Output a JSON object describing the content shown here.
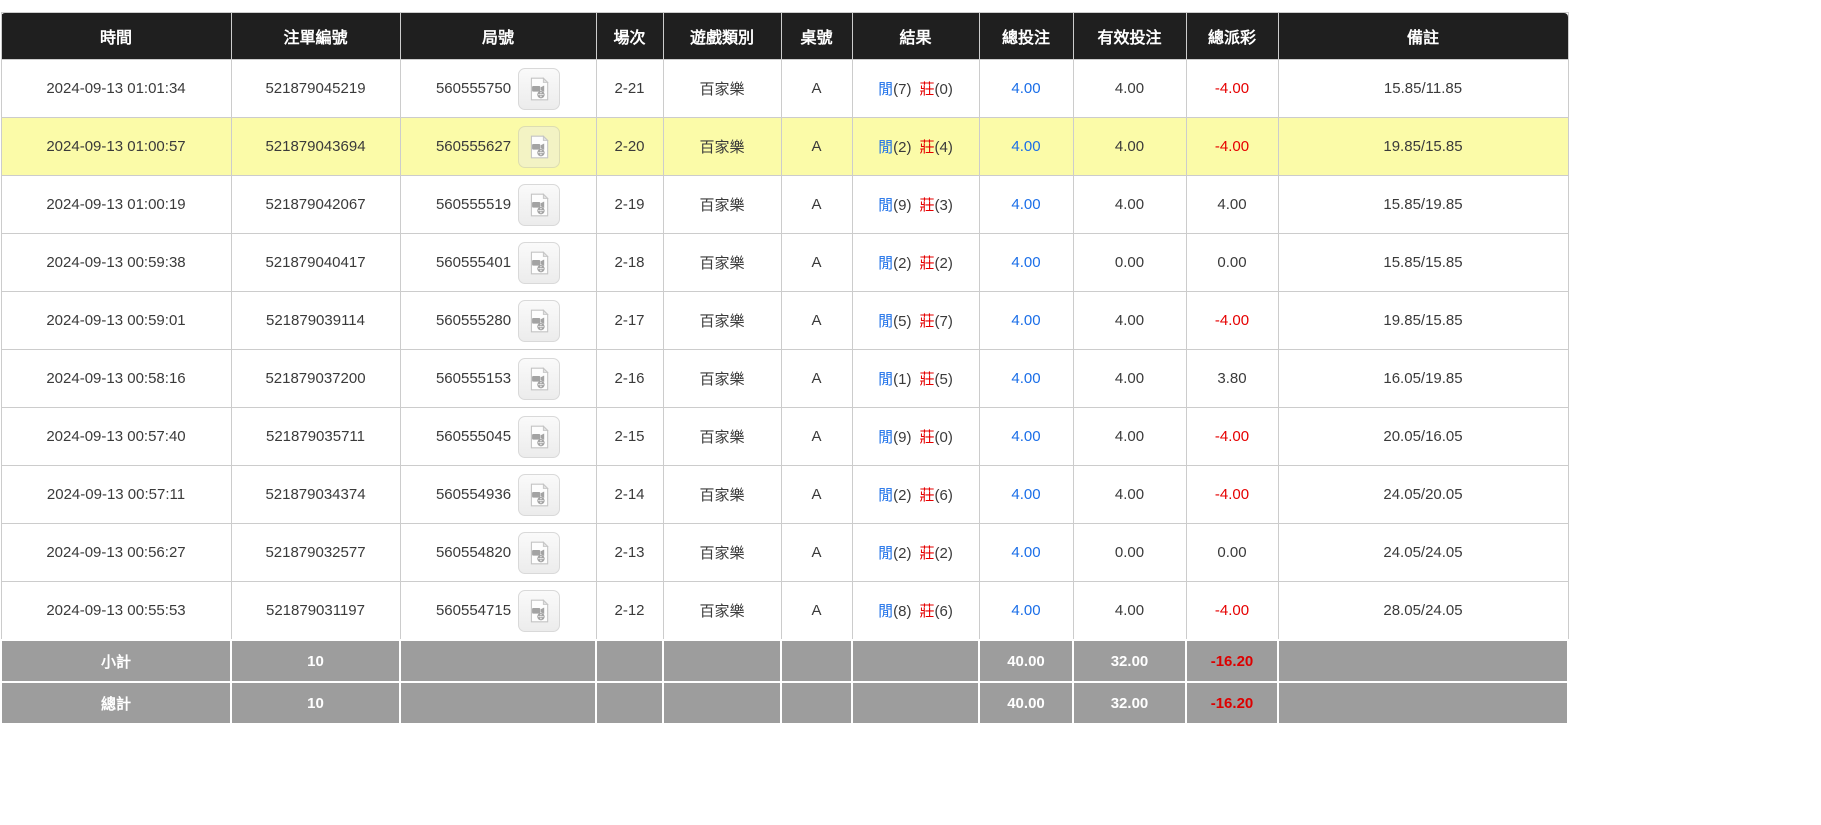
{
  "colors": {
    "accent_blue": "#1a6ee8",
    "negative_red": "#e60000",
    "footer_negative_red": "#dd0000",
    "highlight_yellow": "#fbfba8",
    "header_bg": "#1f1f1f",
    "footer_bg": "#9d9d9d"
  },
  "table": {
    "columns": [
      {
        "key": "time",
        "label": "時間"
      },
      {
        "key": "bet_id",
        "label": "注單編號"
      },
      {
        "key": "round_id",
        "label": "局號"
      },
      {
        "key": "session",
        "label": "場次"
      },
      {
        "key": "game_type",
        "label": "遊戲類別"
      },
      {
        "key": "table_no",
        "label": "桌號"
      },
      {
        "key": "result",
        "label": "結果"
      },
      {
        "key": "total_bet",
        "label": "總投注"
      },
      {
        "key": "valid_bet",
        "label": "有效投注"
      },
      {
        "key": "total_payout",
        "label": "總派彩"
      },
      {
        "key": "remark",
        "label": "備註"
      }
    ],
    "result_labels": {
      "player": "閒",
      "banker": "莊"
    },
    "icons": {
      "round_video": "video-replay-icon"
    },
    "rows": [
      {
        "time": "2024-09-13 01:01:34",
        "bet_id": "521879045219",
        "round_id": "560555750",
        "session": "2-21",
        "game_type": "百家樂",
        "table_no": "A",
        "player_points": "(7)",
        "banker_points": "(0)",
        "total_bet": "4.00",
        "valid_bet": "4.00",
        "total_payout": "-4.00",
        "remark": "15.85/11.85",
        "highlighted": false
      },
      {
        "time": "2024-09-13 01:00:57",
        "bet_id": "521879043694",
        "round_id": "560555627",
        "session": "2-20",
        "game_type": "百家樂",
        "table_no": "A",
        "player_points": "(2)",
        "banker_points": "(4)",
        "total_bet": "4.00",
        "valid_bet": "4.00",
        "total_payout": "-4.00",
        "remark": "19.85/15.85",
        "highlighted": true
      },
      {
        "time": "2024-09-13 01:00:19",
        "bet_id": "521879042067",
        "round_id": "560555519",
        "session": "2-19",
        "game_type": "百家樂",
        "table_no": "A",
        "player_points": "(9)",
        "banker_points": "(3)",
        "total_bet": "4.00",
        "valid_bet": "4.00",
        "total_payout": "4.00",
        "remark": "15.85/19.85",
        "highlighted": false
      },
      {
        "time": "2024-09-13 00:59:38",
        "bet_id": "521879040417",
        "round_id": "560555401",
        "session": "2-18",
        "game_type": "百家樂",
        "table_no": "A",
        "player_points": "(2)",
        "banker_points": "(2)",
        "total_bet": "4.00",
        "valid_bet": "0.00",
        "total_payout": "0.00",
        "remark": "15.85/15.85",
        "highlighted": false
      },
      {
        "time": "2024-09-13 00:59:01",
        "bet_id": "521879039114",
        "round_id": "560555280",
        "session": "2-17",
        "game_type": "百家樂",
        "table_no": "A",
        "player_points": "(5)",
        "banker_points": "(7)",
        "total_bet": "4.00",
        "valid_bet": "4.00",
        "total_payout": "-4.00",
        "remark": "19.85/15.85",
        "highlighted": false
      },
      {
        "time": "2024-09-13 00:58:16",
        "bet_id": "521879037200",
        "round_id": "560555153",
        "session": "2-16",
        "game_type": "百家樂",
        "table_no": "A",
        "player_points": "(1)",
        "banker_points": "(5)",
        "total_bet": "4.00",
        "valid_bet": "4.00",
        "total_payout": "3.80",
        "remark": "16.05/19.85",
        "highlighted": false
      },
      {
        "time": "2024-09-13 00:57:40",
        "bet_id": "521879035711",
        "round_id": "560555045",
        "session": "2-15",
        "game_type": "百家樂",
        "table_no": "A",
        "player_points": "(9)",
        "banker_points": "(0)",
        "total_bet": "4.00",
        "valid_bet": "4.00",
        "total_payout": "-4.00",
        "remark": "20.05/16.05",
        "highlighted": false
      },
      {
        "time": "2024-09-13 00:57:11",
        "bet_id": "521879034374",
        "round_id": "560554936",
        "session": "2-14",
        "game_type": "百家樂",
        "table_no": "A",
        "player_points": "(2)",
        "banker_points": "(6)",
        "total_bet": "4.00",
        "valid_bet": "4.00",
        "total_payout": "-4.00",
        "remark": "24.05/20.05",
        "highlighted": false
      },
      {
        "time": "2024-09-13 00:56:27",
        "bet_id": "521879032577",
        "round_id": "560554820",
        "session": "2-13",
        "game_type": "百家樂",
        "table_no": "A",
        "player_points": "(2)",
        "banker_points": "(2)",
        "total_bet": "4.00",
        "valid_bet": "0.00",
        "total_payout": "0.00",
        "remark": "24.05/24.05",
        "highlighted": false
      },
      {
        "time": "2024-09-13 00:55:53",
        "bet_id": "521879031197",
        "round_id": "560554715",
        "session": "2-12",
        "game_type": "百家樂",
        "table_no": "A",
        "player_points": "(8)",
        "banker_points": "(6)",
        "total_bet": "4.00",
        "valid_bet": "4.00",
        "total_payout": "-4.00",
        "remark": "28.05/24.05",
        "highlighted": false
      }
    ],
    "footer_rows": [
      {
        "label": "小計",
        "count": "10",
        "total_bet": "40.00",
        "valid_bet": "32.00",
        "total_payout": "-16.20"
      },
      {
        "label": "總計",
        "count": "10",
        "total_bet": "40.00",
        "valid_bet": "32.00",
        "total_payout": "-16.20"
      }
    ]
  }
}
